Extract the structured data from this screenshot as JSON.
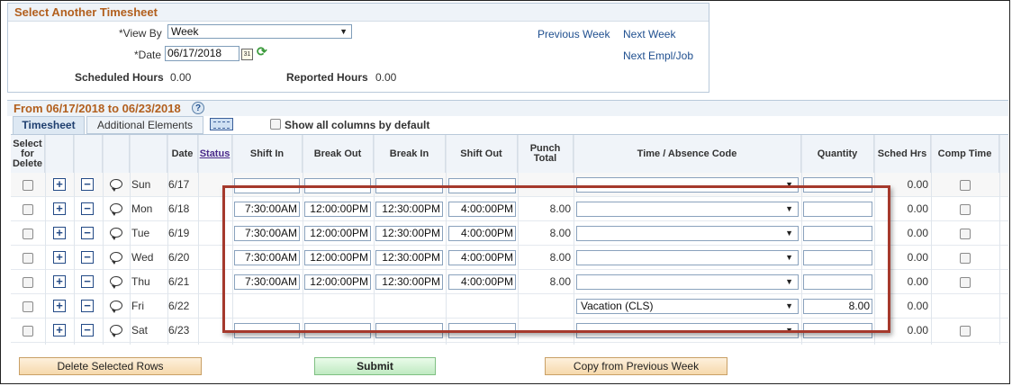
{
  "select_box": {
    "title": "Select Another Timesheet",
    "view_by_label": "*View By",
    "view_by_value": "Week",
    "date_label": "*Date",
    "date_value": "06/17/2018",
    "scheduled_hours_label": "Scheduled Hours",
    "scheduled_hours_value": "0.00",
    "reported_hours_label": "Reported Hours",
    "reported_hours_value": "0.00",
    "links": {
      "previous_week": "Previous Week",
      "next_week": "Next Week",
      "next_empl_job": "Next Empl/Job"
    }
  },
  "period": {
    "title": "From 06/17/2018 to 06/23/2018",
    "help": "?"
  },
  "tabs": [
    {
      "label": "Timesheet",
      "active": true
    },
    {
      "label": "Additional Elements",
      "active": false
    }
  ],
  "show_all_columns_label": "Show all columns by default",
  "columns": {
    "select_for_delete": "Select for Delete",
    "date": "Date",
    "status": "Status",
    "shift_in": "Shift In",
    "break_out": "Break Out",
    "break_in": "Break In",
    "shift_out": "Shift Out",
    "punch_total": "Punch Total",
    "time_absence_code": "Time / Absence Code",
    "quantity": "Quantity",
    "sched_hrs": "Sched Hrs",
    "comp_time": "Comp Time"
  },
  "icons": {
    "add": "+",
    "remove": "−",
    "calendar": "31",
    "refresh": "⟳",
    "dropdown": "▼"
  },
  "rows": [
    {
      "day": "Sun",
      "date": "6/17",
      "shift_in": "",
      "break_out": "",
      "break_in": "",
      "shift_out": "",
      "punch_total": "",
      "code": "",
      "quantity": "",
      "sched_hrs": "0.00"
    },
    {
      "day": "Mon",
      "date": "6/18",
      "shift_in": "7:30:00AM",
      "break_out": "12:00:00PM",
      "break_in": "12:30:00PM",
      "shift_out": "4:00:00PM",
      "punch_total": "8.00",
      "code": "",
      "quantity": "",
      "sched_hrs": "0.00"
    },
    {
      "day": "Tue",
      "date": "6/19",
      "shift_in": "7:30:00AM",
      "break_out": "12:00:00PM",
      "break_in": "12:30:00PM",
      "shift_out": "4:00:00PM",
      "punch_total": "8.00",
      "code": "",
      "quantity": "",
      "sched_hrs": "0.00"
    },
    {
      "day": "Wed",
      "date": "6/20",
      "shift_in": "7:30:00AM",
      "break_out": "12:00:00PM",
      "break_in": "12:30:00PM",
      "shift_out": "4:00:00PM",
      "punch_total": "8.00",
      "code": "",
      "quantity": "",
      "sched_hrs": "0.00"
    },
    {
      "day": "Thu",
      "date": "6/21",
      "shift_in": "7:30:00AM",
      "break_out": "12:00:00PM",
      "break_in": "12:30:00PM",
      "shift_out": "4:00:00PM",
      "punch_total": "8.00",
      "code": "",
      "quantity": "",
      "sched_hrs": "0.00"
    },
    {
      "day": "Fri",
      "date": "6/22",
      "shift_in": "",
      "break_out": "",
      "break_in": "",
      "shift_out": "",
      "punch_total": "",
      "code": "Vacation (CLS)",
      "quantity": "8.00",
      "sched_hrs": "0.00"
    },
    {
      "day": "Sat",
      "date": "6/23",
      "shift_in": "",
      "break_out": "",
      "break_in": "",
      "shift_out": "",
      "punch_total": "",
      "code": "",
      "quantity": "",
      "sched_hrs": "0.00"
    }
  ],
  "buttons": {
    "delete_selected_rows": "Delete Selected Rows",
    "submit": "Submit",
    "copy_from_previous_week": "Copy from Previous Week"
  },
  "colors": {
    "section_title": "#b25f1d",
    "link": "#1f4f8f",
    "highlight_border": "#a5392c"
  }
}
